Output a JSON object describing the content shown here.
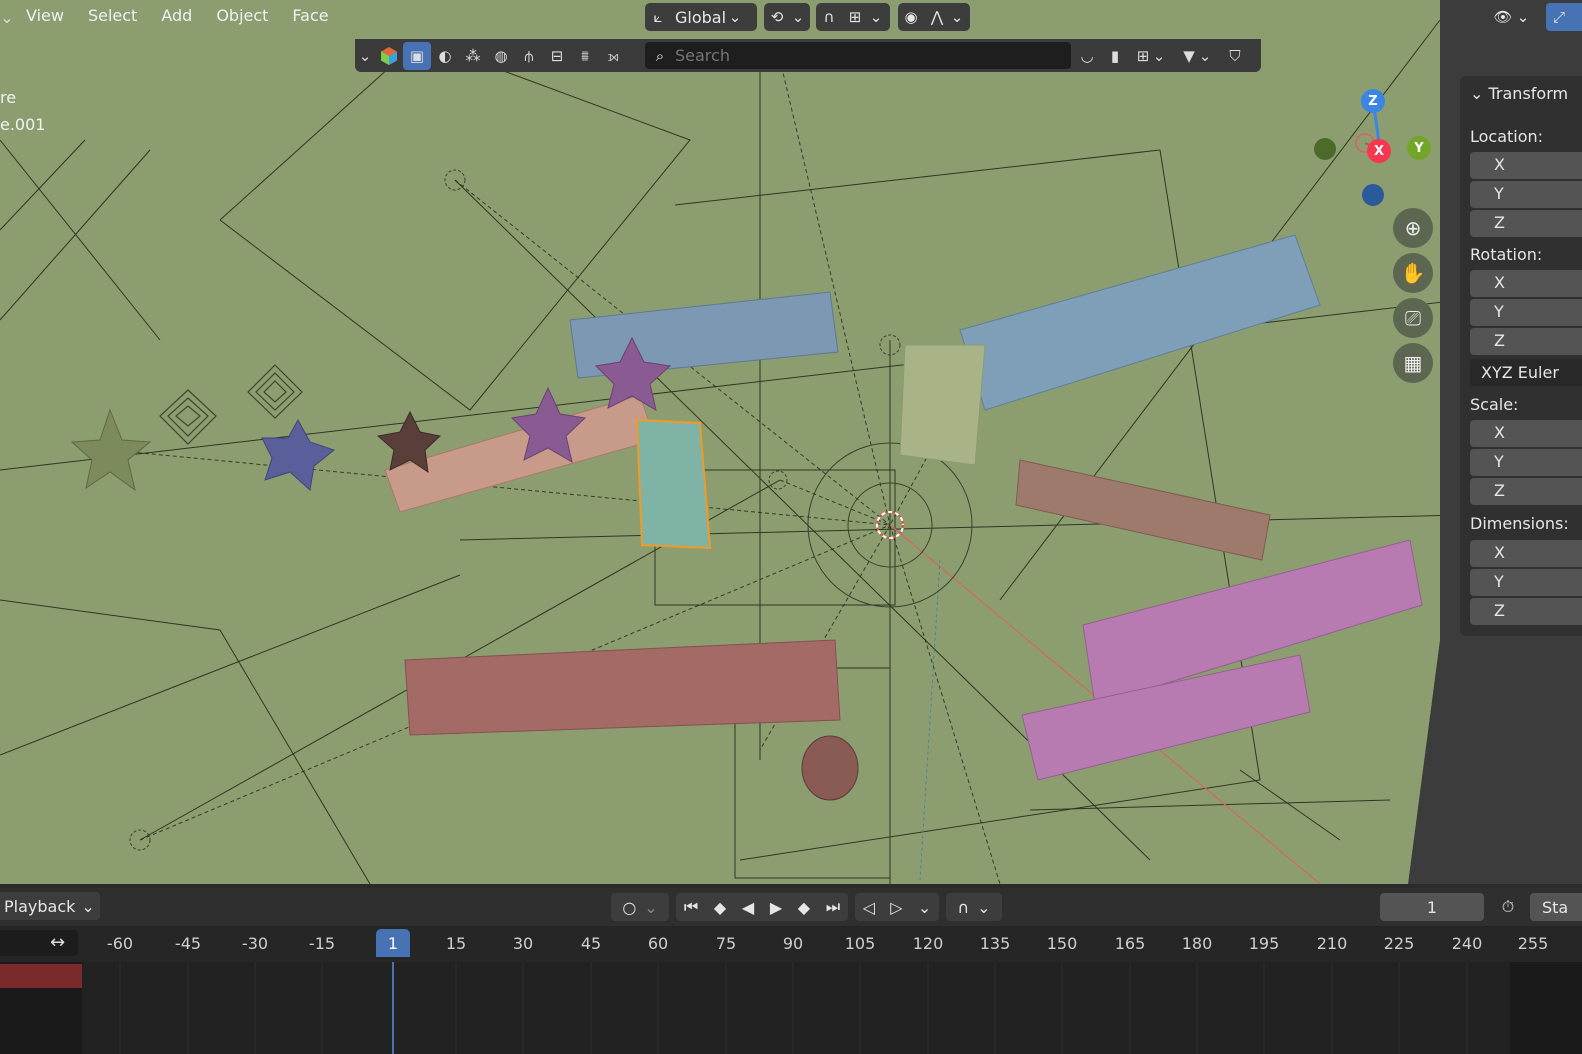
{
  "menu": {
    "items": [
      "View",
      "Select",
      "Add",
      "Object",
      "Face"
    ]
  },
  "header": {
    "orientation_label": "Global"
  },
  "toolbar": {
    "search_placeholder": "Search"
  },
  "viewport": {
    "text_lines": [
      "re",
      "e.001"
    ]
  },
  "gizmo": {
    "z": "Z",
    "x": "X",
    "y": "Y"
  },
  "npanel": {
    "tab_title": "Transform",
    "location_label": "Location:",
    "rotation_label": "Rotation:",
    "rotation_mode": "XYZ Euler",
    "scale_label": "Scale:",
    "dimensions_label": "Dimensions:",
    "axes": [
      "X",
      "Y",
      "Z"
    ]
  },
  "timeline": {
    "playback_label": "Playback",
    "current_frame": "1",
    "start_label": "Sta",
    "frame_marker": "1",
    "ruler_ticks": [
      "-60",
      "-45",
      "-30",
      "-15",
      "15",
      "30",
      "45",
      "60",
      "75",
      "90",
      "105",
      "120",
      "135",
      "150",
      "165",
      "180",
      "195",
      "210",
      "225",
      "240",
      "255"
    ]
  },
  "colors": {
    "viewport_bg": "#8c9e70",
    "accent": "#4772b3",
    "x_axis": "#f5384f",
    "y_axis": "#73a52b",
    "z_axis": "#3b86e3"
  }
}
